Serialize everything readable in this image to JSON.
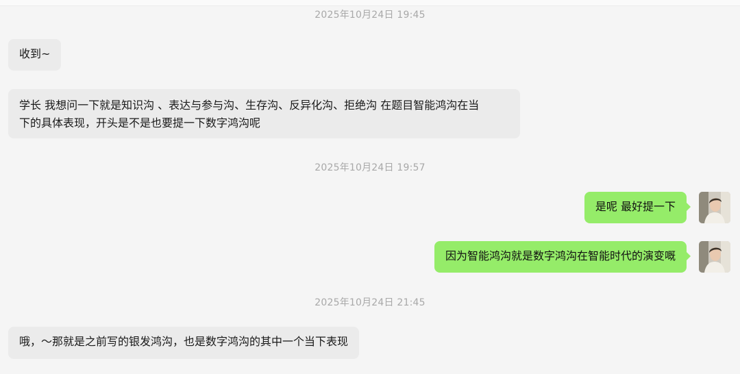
{
  "messages": [
    {
      "type": "timestamp",
      "text": "2025年10月24日 19:45"
    },
    {
      "type": "incoming",
      "text": "收到~"
    },
    {
      "type": "incoming",
      "lines": [
        "学长 我想问一下就是知识沟 、表达与参与沟、生存沟、反异化沟、拒绝沟 在题目智能鸿沟在当",
        "下的具体表现，开头是不是也要提一下数字鸿沟呢"
      ]
    },
    {
      "type": "timestamp",
      "text": "2025年10月24日 19:57"
    },
    {
      "type": "outgoing",
      "text": "是呢 最好提一下"
    },
    {
      "type": "outgoing",
      "text": "因为智能鸿沟就是数字鸿沟在智能时代的演变嘅"
    },
    {
      "type": "timestamp",
      "text": "2025年10月24日 21:45"
    },
    {
      "type": "incoming",
      "text": "哦，～那就是之前写的银发鸿沟，也是数字鸿沟的其中一个当下表现"
    }
  ],
  "colors": {
    "background": "#f5f5f5",
    "incoming_bubble": "#ebebeb",
    "outgoing_bubble": "#95ec69",
    "timestamp_text": "#a8a8a8"
  },
  "icons": {
    "self_avatar": "user-avatar-photo"
  }
}
